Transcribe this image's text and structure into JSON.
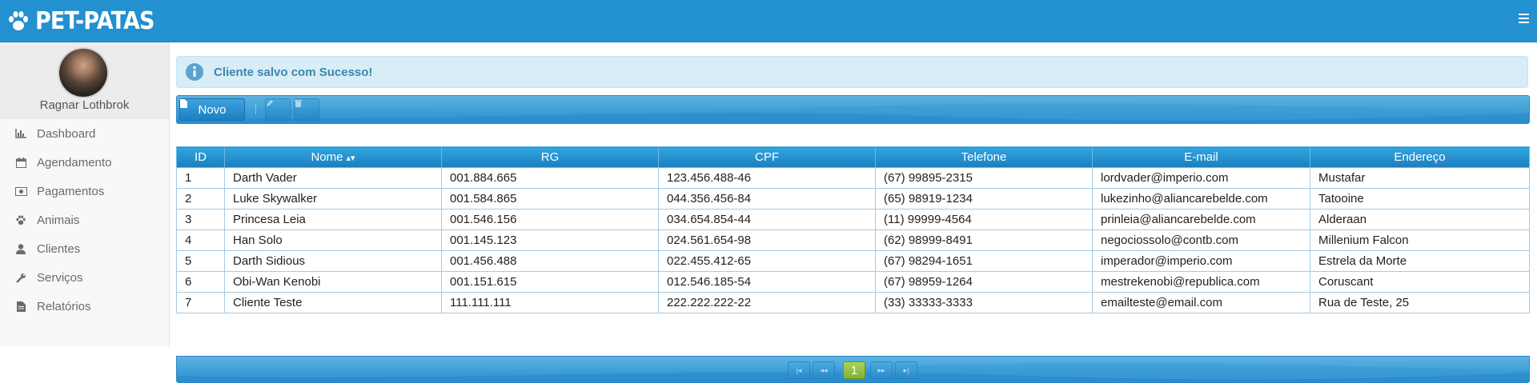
{
  "app": {
    "title": "PET-PATAS"
  },
  "user": {
    "name": "Ragnar Lothbrok"
  },
  "sidebar": {
    "items": [
      {
        "label": "Dashboard",
        "icon": "bar-chart-icon"
      },
      {
        "label": "Agendamento",
        "icon": "calendar-icon"
      },
      {
        "label": "Pagamentos",
        "icon": "money-icon"
      },
      {
        "label": "Animais",
        "icon": "paw-icon"
      },
      {
        "label": "Clientes",
        "icon": "user-icon"
      },
      {
        "label": "Serviços",
        "icon": "wrench-icon"
      },
      {
        "label": "Relatórios",
        "icon": "file-icon"
      }
    ]
  },
  "alert": {
    "message": "Cliente salvo com Sucesso!",
    "icon": "info-icon"
  },
  "toolbar": {
    "new_label": "Novo"
  },
  "table": {
    "columns": [
      "ID",
      "Nome",
      "RG",
      "CPF",
      "Telefone",
      "E-mail",
      "Endereço"
    ],
    "rows": [
      [
        "1",
        "Darth Vader",
        "001.884.665",
        "123.456.488-46",
        "(67) 99895-2315",
        "lordvader@imperio.com",
        "Mustafar"
      ],
      [
        "2",
        "Luke Skywalker",
        "001.584.865",
        "044.356.456-84",
        "(65) 98919-1234",
        "lukezinho@aliancarebelde.com",
        "Tatooine"
      ],
      [
        "3",
        "Princesa Leia",
        "001.546.156",
        "034.654.854-44",
        "(11) 99999-4564",
        "prinleia@aliancarebelde.com",
        "Alderaan"
      ],
      [
        "4",
        "Han Solo",
        "001.145.123",
        "024.561.654-98",
        "(62) 98999-8491",
        "negociossolo@contb.com",
        "Millenium Falcon"
      ],
      [
        "5",
        "Darth Sidious",
        "001.456.488",
        "022.455.412-65",
        "(67) 98294-1651",
        "imperador@imperio.com",
        "Estrela da Morte"
      ],
      [
        "6",
        "Obi-Wan Kenobi",
        "001.151.615",
        "012.546.185-54",
        "(67) 98959-1264",
        "mestrekenobi@republica.com",
        "Coruscant"
      ],
      [
        "7",
        "Cliente Teste",
        "111.111.111",
        "222.222.222-22",
        "(33) 33333-3333",
        "emailteste@email.com",
        "Rua de Teste, 25"
      ]
    ]
  },
  "pager": {
    "current_page": "1"
  }
}
